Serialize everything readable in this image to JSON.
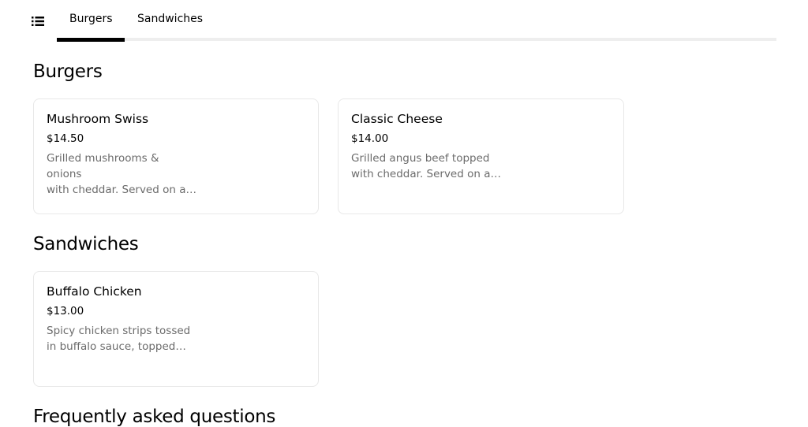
{
  "nav": {
    "menu_icon": "list-icon",
    "tabs": [
      {
        "label": "Burgers",
        "active": true
      },
      {
        "label": "Sandwiches",
        "active": false
      }
    ]
  },
  "sections": [
    {
      "title": "Burgers",
      "items": [
        {
          "name": "Mushroom Swiss",
          "price": "$14.50",
          "description": "Grilled mushrooms & onions\nwith cheddar. Served on a…"
        },
        {
          "name": "Classic Cheese",
          "price": "$14.00",
          "description": "Grilled angus beef topped\nwith cheddar. Served on a…"
        }
      ]
    },
    {
      "title": "Sandwiches",
      "items": [
        {
          "name": "Buffalo Chicken",
          "price": "$13.00",
          "description": "Spicy chicken strips tossed\nin buffalo sauce, topped…"
        }
      ]
    }
  ],
  "faq": {
    "title": "Frequently asked questions"
  },
  "colors": {
    "text": "#000000",
    "muted": "#6b6b6b",
    "border": "#e8e8e8",
    "track": "#eeeeee"
  }
}
